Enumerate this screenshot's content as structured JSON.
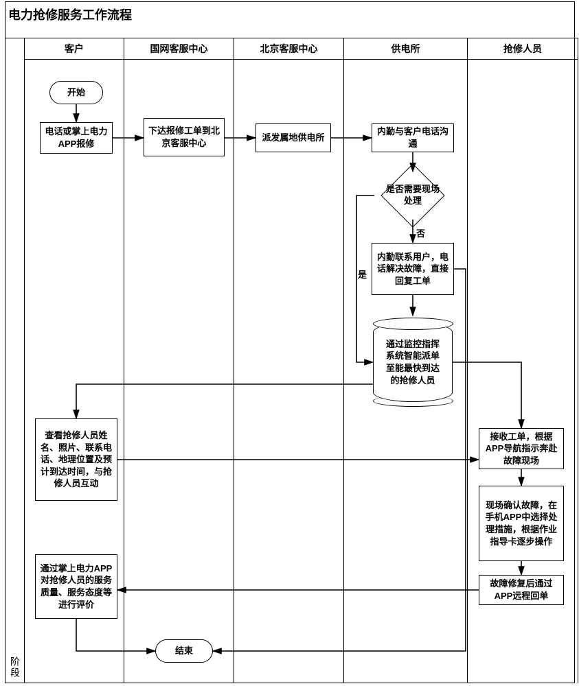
{
  "title": "电力抢修服务工作流程",
  "phase_label": "阶段",
  "lanes": {
    "customer": "客户",
    "sg_center": "国网客服中心",
    "bj_center": "北京客服中心",
    "power_station": "供电所",
    "repair_staff": "抢修人员"
  },
  "nodes": {
    "start": "开始",
    "end": "结束",
    "report": "电话或掌上电力APP报修",
    "issue_ticket": "下达报修工单到北京客服中心",
    "dispatch_local": "派发属地供电所",
    "back_office": "内勤与客户电话沟通",
    "need_onsite": "是否需要现场处理",
    "phone_resolve": "内勤联系用户，电话解决故障，直接回复工单",
    "smart_dispatch": "通过监控指挥系统智能派单至能最快到达的抢修人员",
    "customer_view": "查看抢修人员姓名、照片、联系电话、地理位置及预计到达时间，与抢修人员互动",
    "receive_nav": "接收工单，根据APP导航指示奔赴故障现场",
    "onsite_ops": "现场确认故障，在手机APP中选择处理措施，根据作业指导卡逐步操作",
    "close_ticket": "故障修复后通过APP远程回单",
    "customer_rate": "通过掌上电力APP对抢修人员的服务质量、服务态度等进行评价"
  },
  "edges": {
    "yes": "是",
    "no": "否"
  }
}
